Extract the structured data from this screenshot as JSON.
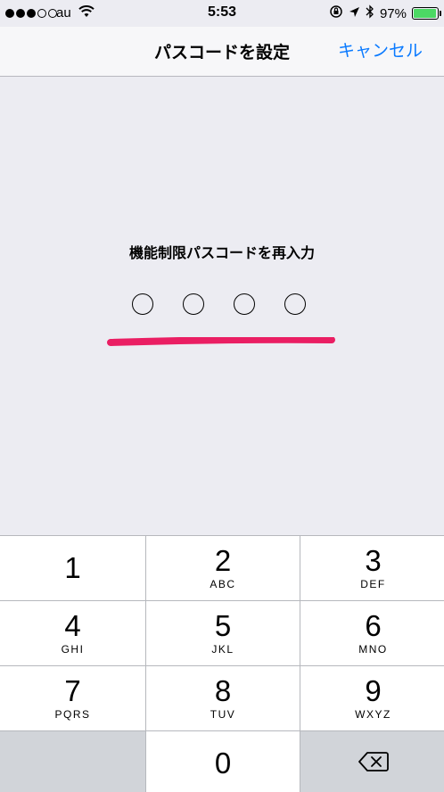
{
  "status_bar": {
    "carrier": "au",
    "time": "5:53",
    "battery_percent": "97%",
    "battery_level": 0.97,
    "signal_bars": [
      true,
      true,
      true,
      false,
      false
    ]
  },
  "nav": {
    "title": "パスコードを設定",
    "cancel": "キャンセル"
  },
  "prompt": "機能制限パスコードを再入力",
  "passcode": {
    "length": 4,
    "entered": 0
  },
  "accent_color": "#0a7aff",
  "annotation_color": "#ea1e63",
  "keypad": {
    "keys": [
      {
        "digit": "1",
        "letters": ""
      },
      {
        "digit": "2",
        "letters": "ABC"
      },
      {
        "digit": "3",
        "letters": "DEF"
      },
      {
        "digit": "4",
        "letters": "GHI"
      },
      {
        "digit": "5",
        "letters": "JKL"
      },
      {
        "digit": "6",
        "letters": "MNO"
      },
      {
        "digit": "7",
        "letters": "PQRS"
      },
      {
        "digit": "8",
        "letters": "TUV"
      },
      {
        "digit": "9",
        "letters": "WXYZ"
      },
      {
        "digit": "0",
        "letters": ""
      }
    ]
  }
}
